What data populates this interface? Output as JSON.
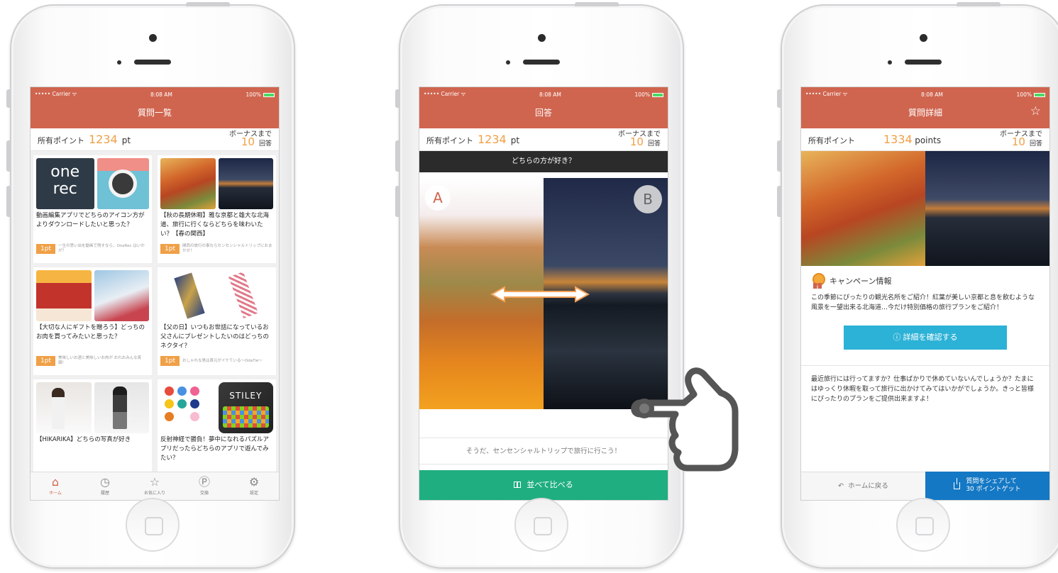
{
  "status_bar": {
    "carrier": "••••• Carrier ᯤ",
    "time": "8:08 AM",
    "battery": "100%"
  },
  "screen1": {
    "title": "質問一覧",
    "points_label": "所有ポイント",
    "points_value": "1234",
    "points_unit": "pt",
    "bonus_label": "ボーナスまで",
    "bonus_value": "10",
    "bonus_unit": "回答",
    "cards": [
      {
        "title": "動画編集アプリでどちらのアイコン方がよりダウンロードしたいと思った？",
        "pt": "1pt",
        "sub": "一生の思い出を動画で残すなら、OneRec はいかが？",
        "img_left_text": "one rec"
      },
      {
        "title": "【秋の長期休暇】雅な京都と雄大な北海道、旅行に行くならどちらを味わいたい？【春の関西】",
        "pt": "1pt",
        "sub": "関西の旅行の事ならセンセンシャルトリップにおまかせ！"
      },
      {
        "title": "【大切な人にギフトを贈ろう】どっちのお肉を買ってみたいと思った？",
        "pt": "1pt",
        "sub": "美味しいお酒と美味しいお肉が おれおみんな笑顔！"
      },
      {
        "title": "【父の日】いつもお世話になっているお父さんにプレゼントしたいのはどっちのネクタイ？",
        "pt": "1pt",
        "sub": "おしゃれな男は首元がイケている〜OdaTie〜"
      },
      {
        "title": "【HIKARIKA】どちらの写真が好き",
        "pt": "",
        "sub": ""
      },
      {
        "title": "反射神経で勝負！夢中になれるパズルアプリだったらどちらのアプリで遊んでみたい？",
        "pt": "",
        "sub": "",
        "img_right_text": "STILEY"
      }
    ],
    "tabs": [
      {
        "label": "ホーム",
        "icon": "home-icon"
      },
      {
        "label": "履歴",
        "icon": "clock-icon"
      },
      {
        "label": "お気に入り",
        "icon": "star-icon"
      },
      {
        "label": "交換",
        "icon": "exchange-icon"
      },
      {
        "label": "設定",
        "icon": "gear-icon"
      }
    ]
  },
  "screen2": {
    "title": "回答",
    "points_label": "所有ポイント",
    "points_value": "1234",
    "points_unit": "pt",
    "bonus_label": "ボーナスまで",
    "bonus_value": "10",
    "bonus_unit": "回答",
    "question": "どちらの方が好き？",
    "option_a": "A",
    "option_b": "B",
    "answer_text": "そうだ、センセンシャルトリップで旅行に行こう！",
    "compare_button": "並べて比べる"
  },
  "screen3": {
    "title": "質問詳細",
    "points_label": "所有ポイント",
    "points_value": "1334",
    "points_unit": "points",
    "bonus_label": "ボーナスまで",
    "bonus_value": "10",
    "bonus_unit": "回答",
    "campaign_title": "キャンペーン情報",
    "campaign_body": "この季節にぴったりの観光名所をご紹介！紅葉が美しい京都と息を飲むような風景を一望出来る北海道…今だけ特別価格の旅行プランをご紹介！",
    "detail_button": "ⓘ 詳細を確認する",
    "description": "最近旅行には行ってますか？仕事ばかりで休めていないんでしょうか？たまにはゆっくり休暇を取って旅行に出かけてみてはいかがでしょうか。きっと皆様にぴったりのプランをご提供出来ますよ！",
    "home_link": "ホームに戻る",
    "share_line1": "質問をシェアして",
    "share_line2": "30 ポイントゲット"
  },
  "colors": {
    "nav": "#d0654f",
    "accent": "#f0a046",
    "compare": "#1fae80",
    "info": "#2cb2d6",
    "share": "#1478c4"
  }
}
